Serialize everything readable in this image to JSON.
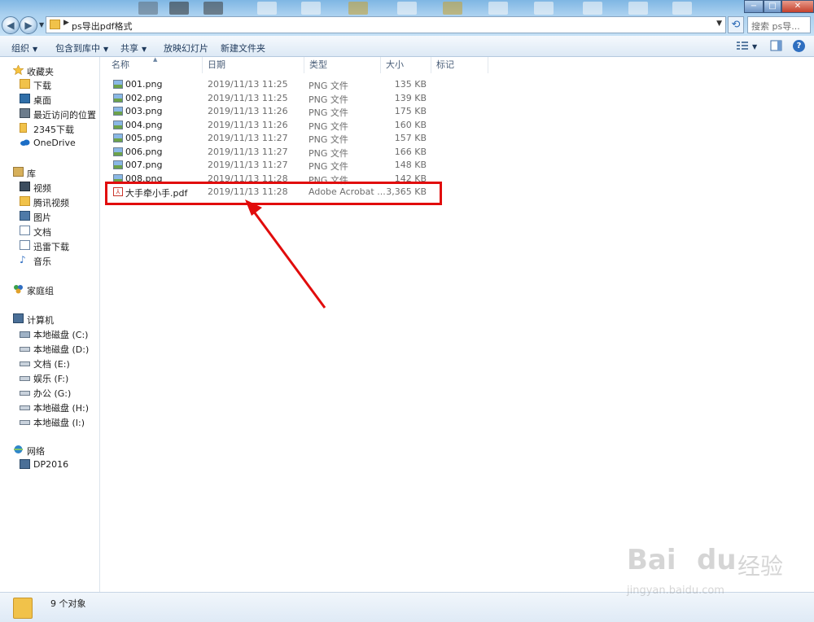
{
  "window": {
    "path": "ps导出pdf格式",
    "search_placeholder": "搜索 ps导...",
    "controls": {
      "minimize": "−",
      "maximize": "□",
      "close": "✕"
    }
  },
  "toolbar": {
    "organize": "组织",
    "include_in_library": "包含到库中",
    "share": "共享",
    "slideshow": "放映幻灯片",
    "new_folder": "新建文件夹",
    "help_icon": "?"
  },
  "sidebar": {
    "favorites": "收藏夹",
    "favorites_items": [
      "下载",
      "桌面",
      "最近访问的位置",
      "2345下载",
      "OneDrive"
    ],
    "library": "库",
    "library_items": [
      "视频",
      "腾讯视频",
      "图片",
      "文档",
      "迅雷下载",
      "音乐"
    ],
    "homegroup": "家庭组",
    "computer": "计算机",
    "computer_items": [
      "本地磁盘 (C:)",
      "本地磁盘 (D:)",
      "文档 (E:)",
      "娱乐 (F:)",
      "办公 (G:)",
      "本地磁盘 (H:)",
      "本地磁盘 (I:)"
    ],
    "network": "网络",
    "network_items": [
      "DP2016"
    ]
  },
  "columns": {
    "name": "名称",
    "date": "日期",
    "type": "类型",
    "size": "大小",
    "tags": "标记"
  },
  "files": [
    {
      "name": "001.png",
      "date": "2019/11/13 11:25",
      "type": "PNG 文件",
      "size": "135 KB"
    },
    {
      "name": "002.png",
      "date": "2019/11/13 11:25",
      "type": "PNG 文件",
      "size": "139 KB"
    },
    {
      "name": "003.png",
      "date": "2019/11/13 11:26",
      "type": "PNG 文件",
      "size": "175 KB"
    },
    {
      "name": "004.png",
      "date": "2019/11/13 11:26",
      "type": "PNG 文件",
      "size": "160 KB"
    },
    {
      "name": "005.png",
      "date": "2019/11/13 11:27",
      "type": "PNG 文件",
      "size": "157 KB"
    },
    {
      "name": "006.png",
      "date": "2019/11/13 11:27",
      "type": "PNG 文件",
      "size": "166 KB"
    },
    {
      "name": "007.png",
      "date": "2019/11/13 11:27",
      "type": "PNG 文件",
      "size": "148 KB"
    },
    {
      "name": "008.png",
      "date": "2019/11/13 11:28",
      "type": "PNG 文件",
      "size": "142 KB"
    },
    {
      "name": "大手牵小手.pdf",
      "date": "2019/11/13 11:28",
      "type": "Adobe Acrobat ...",
      "size": "3,365 KB"
    }
  ],
  "status": {
    "count": "9 个对象"
  },
  "watermark": {
    "brand": "Bai",
    "brand2": "du",
    "cn": "经验",
    "url": "jingyan.baidu.com"
  },
  "colors": {
    "highlight": "#e10c0c",
    "folder": "#f1c24a"
  }
}
